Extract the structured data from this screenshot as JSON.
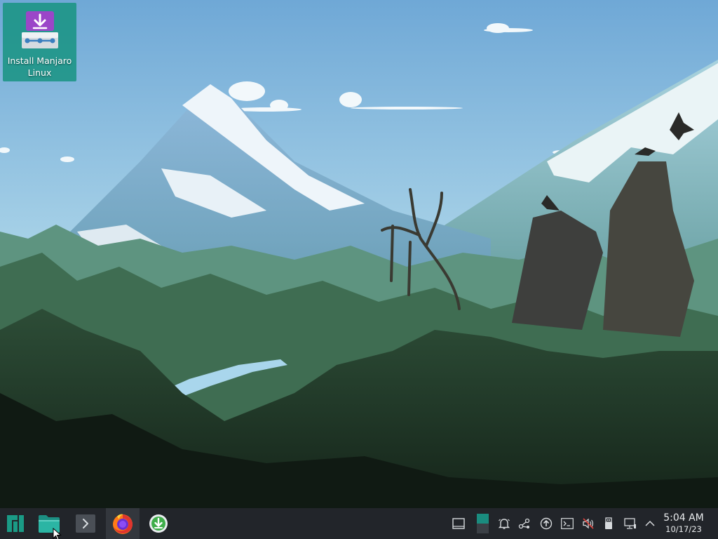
{
  "desktop": {
    "icons": [
      {
        "label": "Install Manjaro Linux",
        "icon": "install-download-icon",
        "color": "#1a9484"
      }
    ]
  },
  "taskbar": {
    "background": "#22252a",
    "launchers": [
      {
        "name": "application-launcher",
        "icon": "manjaro-logo-icon"
      },
      {
        "name": "file-manager",
        "icon": "folder-icon"
      },
      {
        "name": "terminal",
        "icon": "terminal-icon"
      },
      {
        "name": "firefox",
        "icon": "firefox-icon",
        "active": true
      },
      {
        "name": "installer",
        "icon": "download-circle-icon"
      }
    ],
    "tray": [
      "show-desktop-icon",
      "pager",
      "notifications-bell-icon",
      "kde-connect-icon",
      "updates-icon",
      "terminal-tray-icon",
      "volume-muted-icon",
      "usb-device-icon",
      "network-wired-icon",
      "expand-tray-chevron-icon"
    ],
    "clock": {
      "time": "5:04 AM",
      "date": "10/17/23"
    }
  },
  "accent": "#1a9484"
}
